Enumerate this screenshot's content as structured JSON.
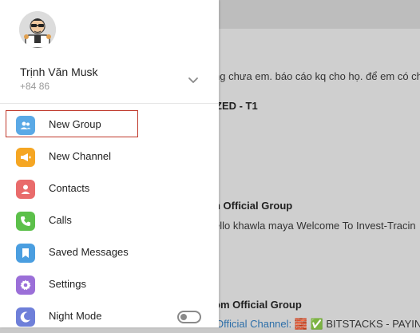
{
  "user": {
    "name": "Trịnh Văn Musk",
    "phone": "+84 86"
  },
  "menu": [
    {
      "label": "New Group",
      "icon": "group-icon",
      "color": "#5aa9e6"
    },
    {
      "label": "New Channel",
      "icon": "megaphone-icon",
      "color": "#f5a623"
    },
    {
      "label": "Contacts",
      "icon": "contact-icon",
      "color": "#e96b6b"
    },
    {
      "label": "Calls",
      "icon": "phone-icon",
      "color": "#5cc04a"
    },
    {
      "label": "Saved Messages",
      "icon": "bookmark-icon",
      "color": "#4a9ee0"
    },
    {
      "label": "Settings",
      "icon": "gear-icon",
      "color": "#9b6fd8"
    },
    {
      "label": "Night Mode",
      "icon": "moon-icon",
      "color": "#6e7fd9"
    }
  ],
  "night_mode": {
    "enabled": false
  },
  "background": {
    "line1": "ng chưa em. báo cáo kq cho họ. để em có cha",
    "title1": "ZED - T1",
    "title2": "n Official Group",
    "line2": "ello khawla maya Welcome To Invest-Tracin",
    "title3": "om Official Group",
    "line3_link": "Official Channel:",
    "line3_rest": " 🧱 ✅ BITSTACKS - PAYIN"
  }
}
